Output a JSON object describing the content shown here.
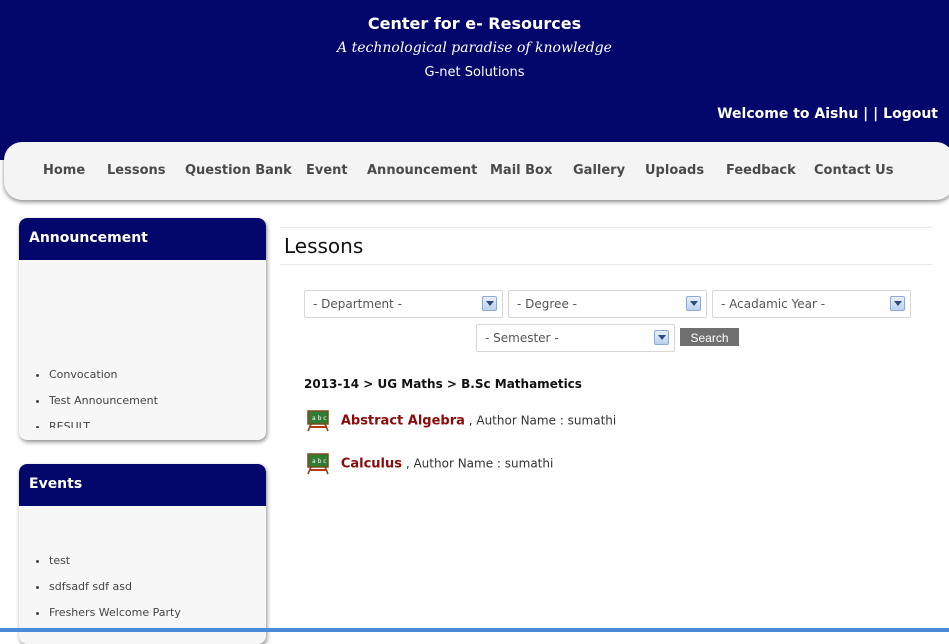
{
  "header": {
    "title": "Center for e- Resources",
    "tagline": "A technological paradise of knowledge",
    "company": "G-net Solutions",
    "welcome_text": "Welcome to Aishu",
    "separator": "| |",
    "logout": "Logout"
  },
  "nav": [
    "Home",
    "Lessons",
    "Question Bank",
    "Event",
    "Announcement",
    "Mail Box",
    "Gallery",
    "Uploads",
    "Feedback",
    "Contact Us"
  ],
  "announcement_panel": {
    "title": "Announcement",
    "items": [
      "Convocation",
      "Test Announcement",
      "RESULT"
    ]
  },
  "events_panel": {
    "title": "Events",
    "items": [
      "test",
      "sdfsadf sdf asd",
      "Freshers Welcome Party"
    ]
  },
  "main": {
    "page_title": "Lessons",
    "filters": {
      "department": "- Department -",
      "degree": "- Degree -",
      "academic_year": "- Acadamic Year -",
      "semester": "- Semester -",
      "search_label": "Search"
    },
    "breadcrumb": "2013-14 > UG Maths > B.Sc Mathametics",
    "lessons": [
      {
        "title": "Abstract Algebra",
        "author_label": ", Author Name :",
        "author": "sumathi"
      },
      {
        "title": "Calculus",
        "author_label": ", Author Name :",
        "author": "sumathi"
      }
    ],
    "lesson_icon": "chalkboard-icon"
  },
  "colors": {
    "header_bg": "#03066b",
    "nav_bg": "#f4f4f4",
    "lesson_link": "#8b0a0a",
    "search_button": "#6f6f6f"
  }
}
